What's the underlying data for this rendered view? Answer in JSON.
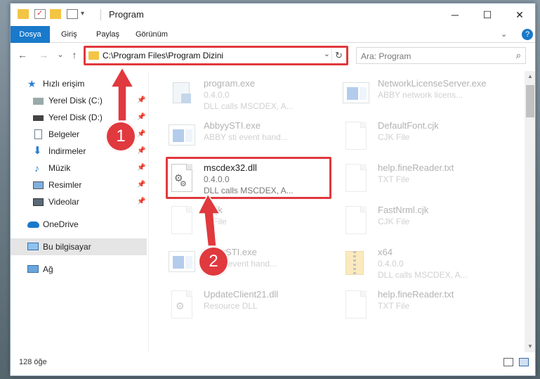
{
  "window": {
    "title": "Program",
    "minimize": "─",
    "maximize": "☐",
    "close": "✕"
  },
  "ribbon": {
    "tabs": [
      "Dosya",
      "Giriş",
      "Paylaş",
      "Görünüm"
    ],
    "chevron": "⌄",
    "help": "?"
  },
  "nav": {
    "back": "←",
    "forward": "→",
    "recent": "⌄",
    "up": "↑",
    "address": "C:\\Program Files\\Program Dizini",
    "refresh": "↻",
    "dropdown": "⌄",
    "search_placeholder": "Ara: Program",
    "search_icon": "⌕"
  },
  "sidebar": {
    "items": [
      {
        "label": "Hızlı erişim",
        "icon": "star-icon"
      },
      {
        "label": "Yerel Disk (C:)",
        "icon": "drive-icon"
      },
      {
        "label": "Yerel Disk (D:)",
        "icon": "drive-icon"
      },
      {
        "label": "Belgeler",
        "icon": "documents-icon"
      },
      {
        "label": "İndirmeler",
        "icon": "download-icon"
      },
      {
        "label": "Müzik",
        "icon": "music-icon"
      },
      {
        "label": "Resimler",
        "icon": "pictures-icon"
      },
      {
        "label": "Videolar",
        "icon": "videos-icon"
      },
      {
        "label": "OneDrive",
        "icon": "cloud-icon"
      },
      {
        "label": "Bu bilgisayar",
        "icon": "computer-icon"
      },
      {
        "label": "Ağ",
        "icon": "network-icon"
      }
    ]
  },
  "files": [
    {
      "name": "program.exe",
      "l1": "0.4.0.0",
      "l2": "DLL calls MSCDEX, A..."
    },
    {
      "name": "NetworkLicenseServer.exe",
      "l1": "ABBY network licens...",
      "l2": ""
    },
    {
      "name": "AbbyySTI.exe",
      "l1": "ABBY sti event hand...",
      "l2": ""
    },
    {
      "name": "DefaultFont.cjk",
      "l1": "CJK File",
      "l2": ""
    },
    {
      "name": "mscdex32.dll",
      "l1": "0.4.0.0",
      "l2": "DLL calls MSCDEX, A..."
    },
    {
      "name": "help.fineReader.txt",
      "l1": "TXT File",
      "l2": ""
    },
    {
      "name": "...cjk",
      "l1": "... File",
      "l2": ""
    },
    {
      "name": "FastNrml.cjk",
      "l1": "CJK File",
      "l2": ""
    },
    {
      "name": "...byySTI.exe",
      "l1": "...y sti event hand...",
      "l2": ""
    },
    {
      "name": "x64",
      "l1": "0.4.0.0",
      "l2": "DLL calls MSCDEX, A..."
    },
    {
      "name": "UpdateClient21.dll",
      "l1": "Resource DLL",
      "l2": ""
    },
    {
      "name": "help.fineReader.txt",
      "l1": "TXT File",
      "l2": ""
    }
  ],
  "status": {
    "count": "128 öğe"
  },
  "annotations": {
    "step1": "1",
    "step2": "2"
  },
  "colors": {
    "accent": "#1979ca",
    "highlight": "#e0393e",
    "folder": "#f3c544"
  }
}
